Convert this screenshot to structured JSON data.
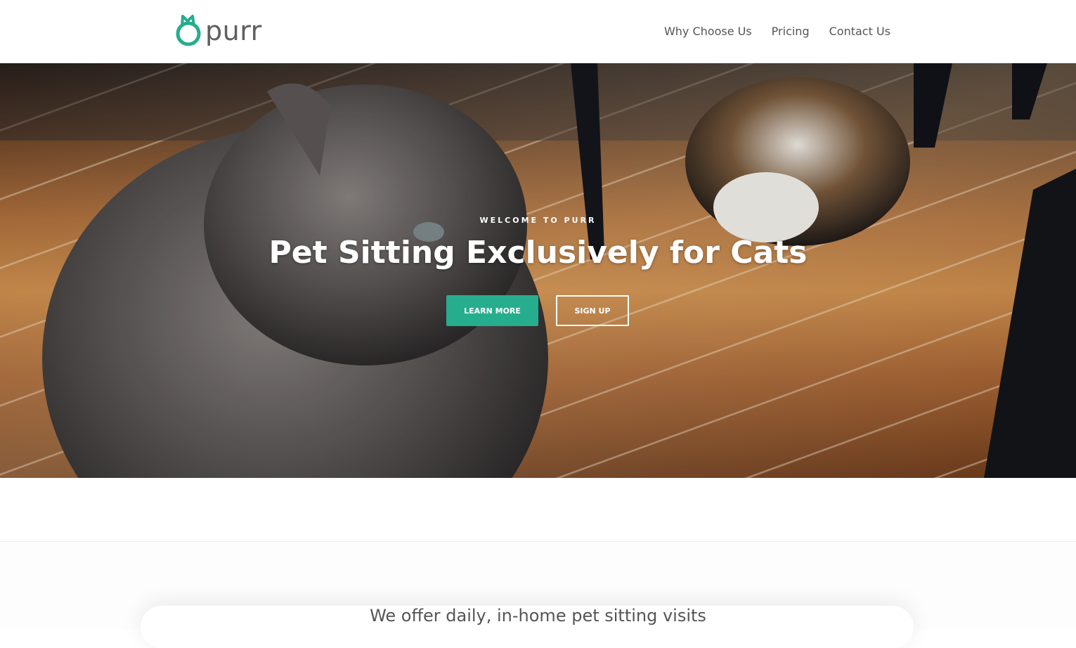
{
  "brand": {
    "name": "purr",
    "accent_color": "#26ad8e",
    "logo_icon": "cat-outline-icon"
  },
  "nav": {
    "items": [
      {
        "label": "Why Choose Us"
      },
      {
        "label": "Pricing"
      },
      {
        "label": "Contact Us"
      }
    ]
  },
  "hero": {
    "eyebrow": "WELCOME TO PURR",
    "headline": "Pet Sitting Exclusively for Cats",
    "primary_button": "LEARN MORE",
    "secondary_button": "SIGN UP",
    "background_image": "cats-on-wood-floor-photo"
  },
  "section": {
    "tagline": "We offer daily, in-home pet sitting visits"
  }
}
